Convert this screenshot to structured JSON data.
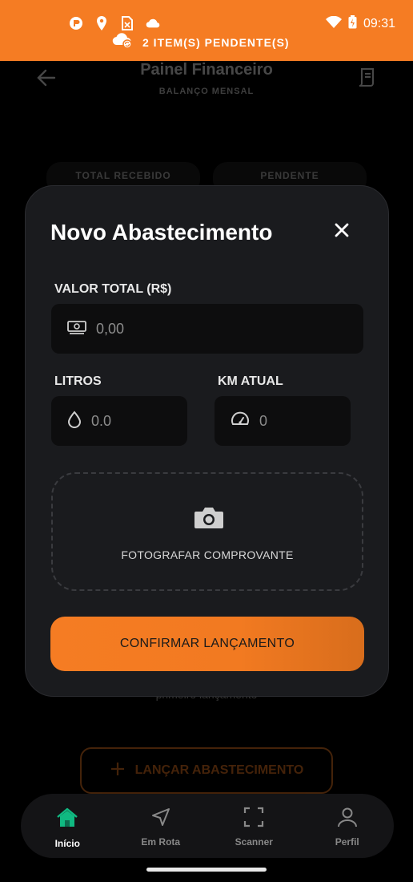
{
  "status_bar": {
    "time": "09:31",
    "pending_label": "2 ITEM(S) PENDENTE(S)",
    "icons": [
      "app-icon",
      "location-icon",
      "sim-icon",
      "cloud-icon",
      "wifi-icon",
      "battery-icon",
      "cloud-sync-icon"
    ],
    "background_color": "#f57c23"
  },
  "background_page": {
    "title": "Painel Financeiro",
    "subtitle": "BALANÇO MENSAL",
    "cards": [
      "TOTAL RECEBIDO",
      "PENDENTE"
    ],
    "first_entry_text": "primeiro lançamento",
    "launch_button": "LANÇAR ABASTECIMENTO"
  },
  "modal": {
    "title": "Novo Abastecimento",
    "fields": {
      "valor_total": {
        "label": "VALOR TOTAL (R$)",
        "placeholder": "0,00"
      },
      "litros": {
        "label": "LITROS",
        "placeholder": "0.0"
      },
      "km_atual": {
        "label": "KM ATUAL",
        "placeholder": "0"
      }
    },
    "upload_label": "FOTOGRAFAR COMPROVANTE",
    "confirm_label": "CONFIRMAR LANÇAMENTO",
    "accent_color": "#f57c23"
  },
  "bottom_nav": {
    "items": [
      {
        "label": "Início",
        "icon": "home-icon",
        "active": true
      },
      {
        "label": "Em Rota",
        "icon": "navigation-icon",
        "active": false
      },
      {
        "label": "Scanner",
        "icon": "scan-icon",
        "active": false
      },
      {
        "label": "Perfil",
        "icon": "user-icon",
        "active": false
      }
    ],
    "active_color": "#10b981"
  }
}
